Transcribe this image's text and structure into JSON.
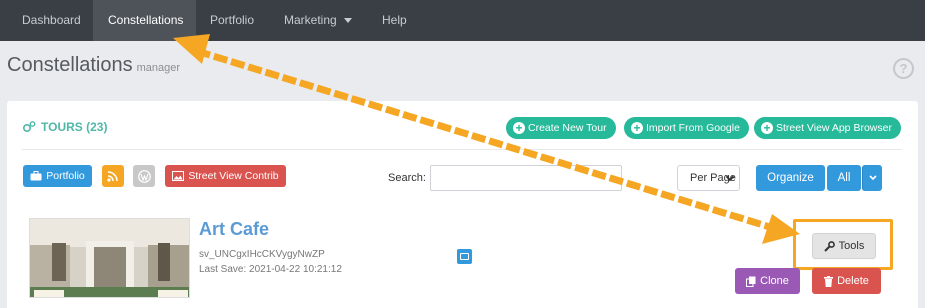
{
  "nav": {
    "items": [
      {
        "label": "Dashboard"
      },
      {
        "label": "Constellations"
      },
      {
        "label": "Portfolio"
      },
      {
        "label": "Marketing"
      },
      {
        "label": "Help"
      }
    ]
  },
  "header": {
    "title": "Constellations",
    "subtitle": "manager",
    "help_icon": "?"
  },
  "tours": {
    "heading": "TOURS (23)",
    "actions": {
      "create": "Create New Tour",
      "import": "Import From Google",
      "browser": "Street View App Browser"
    },
    "toolbar": {
      "portfolio": "Portfolio",
      "street_view_contrib": "Street View Contrib",
      "search_label": "Search:",
      "search_value": "",
      "per_page": "Per Page",
      "organize": "Organize",
      "filter": "All"
    },
    "items": [
      {
        "title": "Art Cafe",
        "id": "sv_UNCgxIHcCKVygyNwZP",
        "last_save": "Last Save: 2021-04-22 10:21:12",
        "tools_label": "Tools",
        "clone_label": "Clone",
        "delete_label": "Delete"
      }
    ]
  },
  "colors": {
    "navbar": "#3a3f46",
    "accent_teal": "#26b99a",
    "accent_blue": "#3399dd",
    "danger": "#d9534f",
    "highlight": "#f5a623"
  }
}
